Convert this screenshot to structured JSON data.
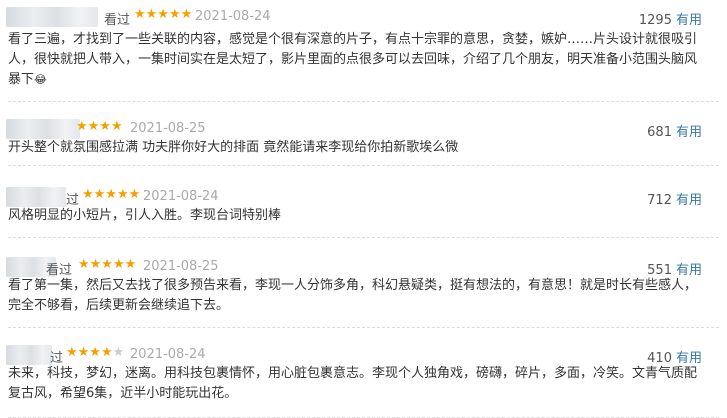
{
  "reviews": [
    {
      "tag": "看过",
      "stars": 5,
      "star_glyphs_on": "★★★★★",
      "star_glyphs_off": "",
      "date": "2021-08-24",
      "count": "1295",
      "useful": "有用",
      "text": "看了三遍，才找到了一些关联的内容，感觉是个很有深意的片子，有点十宗罪的意思，贪婪，嫉妒……片头设计就很吸引人，很快就把人带入，一集时间实在是太短了，影片里面的点很多可以去回味，介绍了几个朋友，明天准备小范围头脑风暴下",
      "emoji": "😂"
    },
    {
      "tag": "",
      "stars": 4,
      "star_glyphs_on": "★★★★",
      "star_glyphs_off": "",
      "date": "2021-08-25",
      "count": "681",
      "useful": "有用",
      "text": "开头整个就氛围感拉满 功夫胖你好大的排面 竟然能请来李现给你拍新歌埃么微",
      "emoji": ""
    },
    {
      "tag": "过",
      "stars": 5,
      "star_glyphs_on": "★★★★★",
      "star_glyphs_off": "",
      "date": "2021-08-24",
      "count": "712",
      "useful": "有用",
      "text": "风格明显的小短片，引人入胜。李现台词特别棒",
      "emoji": ""
    },
    {
      "tag": "看过",
      "stars": 5,
      "star_glyphs_on": "★★★★★",
      "star_glyphs_off": "",
      "date": "2021-08-25",
      "count": "551",
      "useful": "有用",
      "text": "看了第一集，然后又去找了很多预告来看，李现一人分饰多角，科幻悬疑类，挺有想法的，有意思！就是时长有些感人，完全不够看，后续更新会继续追下去。",
      "emoji": ""
    },
    {
      "tag": "过",
      "stars": 4,
      "star_glyphs_on": "★★★★",
      "star_glyphs_off": "★",
      "date": "2021-08-24",
      "count": "410",
      "useful": "有用",
      "text": "未来，科技，梦幻，迷离。用科技包裹情怀，用心脏包裹意志。李现个人独角戏，磅礴，碎片，多面，冷笑。文青气质配复古风，希望6集，近半小时能玩出花。",
      "emoji": ""
    }
  ],
  "colors": {
    "star": "#f4a000",
    "link": "#3377aa",
    "date": "#aaaaaa",
    "text": "#333333"
  }
}
